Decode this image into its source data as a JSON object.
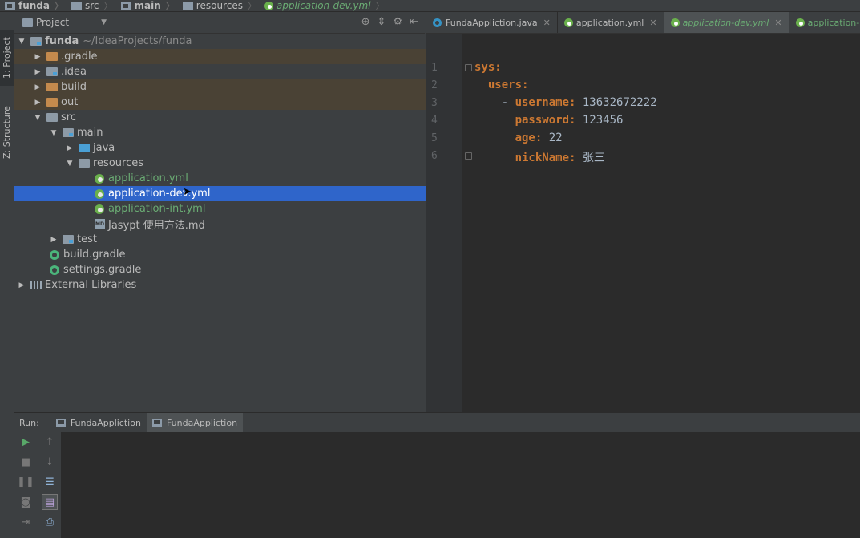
{
  "breadcrumb": [
    "funda",
    "src",
    "main",
    "resources",
    "application-dev.yml"
  ],
  "side_tabs": {
    "project": "1: Project",
    "structure": "Z: Structure"
  },
  "project_panel": {
    "title": "Project"
  },
  "tree": {
    "root_name": "funda",
    "root_path": "~/IdeaProjects/funda",
    "items": [
      {
        "label": ".gradle"
      },
      {
        "label": ".idea"
      },
      {
        "label": "build"
      },
      {
        "label": "out"
      },
      {
        "label": "src"
      },
      {
        "label": "main"
      },
      {
        "label": "java"
      },
      {
        "label": "resources"
      },
      {
        "label": "application.yml"
      },
      {
        "label": "application-dev.yml"
      },
      {
        "label": "application-int.yml"
      },
      {
        "label": "Jasypt 使用方法.md"
      },
      {
        "label": "test"
      },
      {
        "label": "build.gradle"
      },
      {
        "label": "settings.gradle"
      },
      {
        "label": "External Libraries"
      }
    ]
  },
  "editor_tabs": [
    {
      "label": "FundaAppliction.java"
    },
    {
      "label": "application.yml"
    },
    {
      "label": "application-dev.yml"
    },
    {
      "label": "application-int"
    }
  ],
  "editor": {
    "line_numbers": [
      "1",
      "2",
      "3",
      "4",
      "5",
      "6"
    ],
    "lines": [
      {
        "indent": "",
        "key": "sys:",
        "value": ""
      },
      {
        "indent": "  ",
        "key": "users:",
        "value": ""
      },
      {
        "indent": "    - ",
        "key": "username:",
        "value": " 13632672222"
      },
      {
        "indent": "      ",
        "key": "password:",
        "value": " 123456"
      },
      {
        "indent": "      ",
        "key": "age:",
        "value": " 22"
      },
      {
        "indent": "      ",
        "key": "nickName:",
        "value": " 张三"
      }
    ]
  },
  "run": {
    "label": "Run:",
    "tabs": [
      "FundaAppliction",
      "FundaAppliction"
    ]
  }
}
